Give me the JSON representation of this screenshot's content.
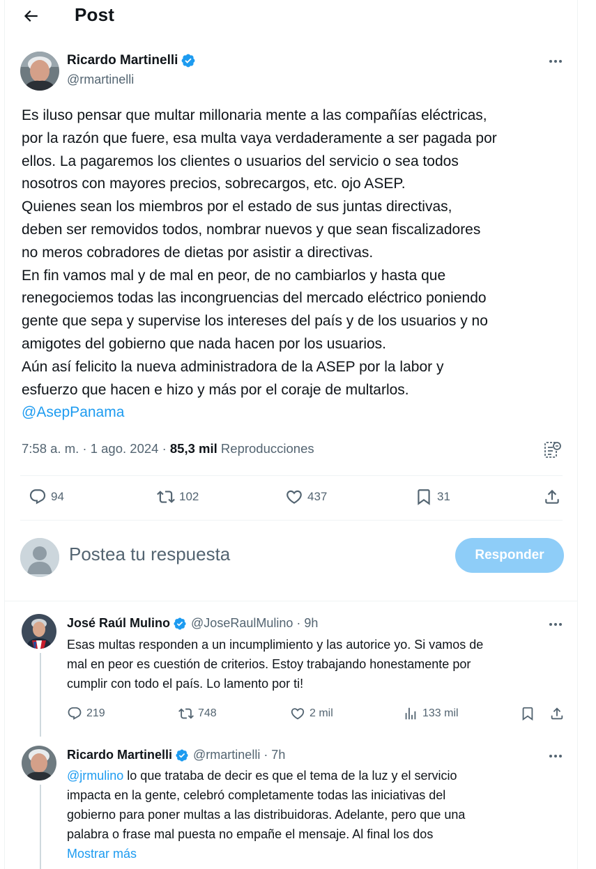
{
  "header": {
    "title": "Post",
    "back_icon": "arrow-left-icon"
  },
  "post": {
    "author_name": "Ricardo Martinelli",
    "author_handle": "@rmartinelli",
    "verified": true,
    "lines": [
      "Es iluso pensar que multar millonaria mente  a las compañías eléctricas,",
      "por la razón que fuere, esa multa vaya verdaderamente a ser pagada por",
      "ellos. La pagaremos los clientes o usuarios del servicio o sea todos",
      "nosotros con mayores  precios, sobrecargos, etc. ojo ASEP.",
      "Quienes sean los miembros por el estado de sus juntas directivas,",
      "deben ser removidos todos, nombrar nuevos y que sean fiscalizadores",
      "no meros cobradores de dietas por asistir a directivas.",
      "En fin vamos mal y de mal en peor, de no cambiarlos y  hasta que",
      "renegociemos todas las incongruencias del mercado eléctrico poniendo",
      "gente que sepa y supervise los intereses del país y de los usuarios y no",
      "amigotes del gobierno que nada hacen por los usuarios.",
      "Aún así felicito la nueva administradora de  la ASEP  por la labor y",
      "esfuerzo que hacen e hizo y más por el coraje de multarlos."
    ],
    "mention": "@AsepPanama",
    "time": "7:58 a. m. · 1 ago. 2024 · ",
    "views_count": "85,3 mil",
    "views_label": " Reproducciones",
    "stats": {
      "replies": "94",
      "reposts": "102",
      "likes": "437",
      "bookmarks": "31"
    }
  },
  "reply_box": {
    "placeholder": "Postea tu respuesta",
    "button": "Responder"
  },
  "replies": [
    {
      "author_name": "José Raúl Mulino",
      "handle_time": "@JoseRaulMulino · 9h",
      "lines": [
        "Esas multas responden a un incumplimiento y las autorice yo. Si vamos de",
        "mal en peor es cuestión de criterios. Estoy trabajando honestamente por",
        "cumplir con todo el país. Lo lamento por ti!"
      ],
      "stats": {
        "replies": "219",
        "reposts": "748",
        "likes": "2 mil",
        "views": "133 mil"
      }
    },
    {
      "author_name": "Ricardo Martinelli",
      "handle_time": "@rmartinelli · 7h",
      "mention": "@jrmulino",
      "first_line_rest": " lo que trataba de decir es que el tema de la luz y el servicio",
      "lines": [
        "impacta en la gente, celebró completamente todas las iniciativas del",
        "gobierno para poner multas a las distribuidoras. Adelante, pero que una",
        "palabra o frase mal puesta no empañe el mensaje. Al final los dos"
      ],
      "show_more": "Mostrar más"
    }
  ],
  "colors": {
    "accent": "#1d9bf0",
    "muted": "#536471",
    "text": "#0f1419",
    "button_disabled": "#8ecdf8"
  }
}
